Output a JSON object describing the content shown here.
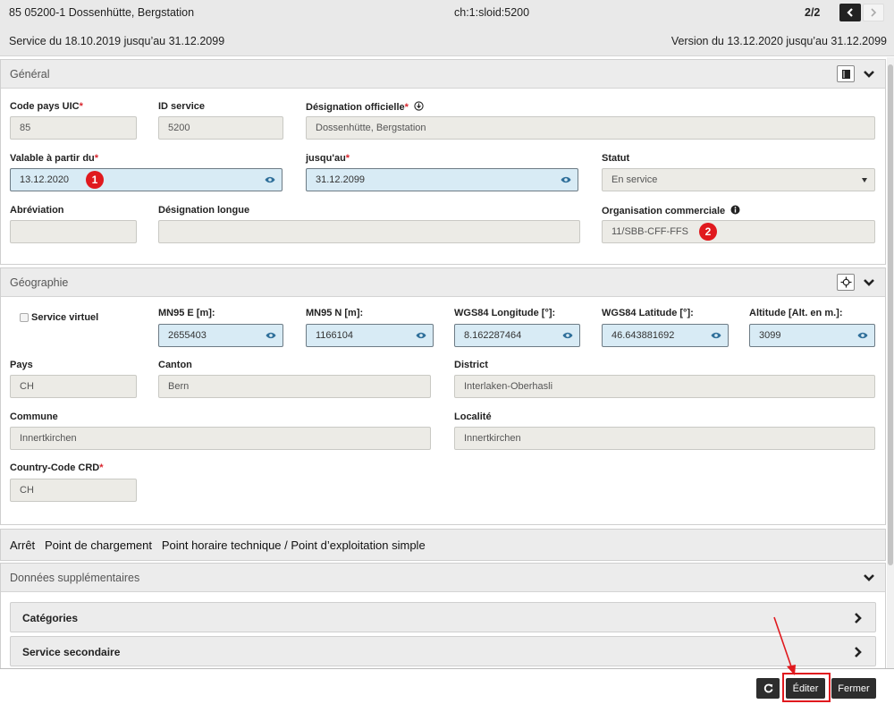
{
  "header": {
    "title": "85 05200-1 Dossenhütte, Bergstation",
    "sloid": "ch:1:sloid:5200",
    "count": "2/2",
    "service": "Service du 18.10.2019 jusqu’au 31.12.2099",
    "version": "Version du 13.12.2020 jusqu’au 31.12.2099"
  },
  "general": {
    "title": "Général",
    "code_pays_label": "Code pays UIC",
    "code_pays_value": "85",
    "id_service_label": "ID service",
    "id_service_value": "5200",
    "designation_officielle_label": "Désignation officielle",
    "designation_officielle_value": "Dossenhütte, Bergstation",
    "valable_label": "Valable à partir du",
    "valable_value": "13.12.2020",
    "jusquau_label": "jusqu'au",
    "jusquau_value": "31.12.2099",
    "statut_label": "Statut",
    "statut_value": "En service",
    "abreviation_label": "Abréviation",
    "abreviation_value": "",
    "designation_longue_label": "Désignation longue",
    "designation_longue_value": "",
    "org_commerciale_label": "Organisation commerciale",
    "org_commerciale_value": "11/SBB-CFF-FFS",
    "required_mark": "*"
  },
  "badges": {
    "one": "1",
    "two": "2"
  },
  "geographie": {
    "title": "Géographie",
    "service_virtuel_label": "Service virtuel",
    "mn95e_label": "MN95 E [m]:",
    "mn95e_value": "2655403",
    "mn95n_label": "MN95 N [m]:",
    "mn95n_value": "1166104",
    "wgs_lon_label": "WGS84 Longitude [°]:",
    "wgs_lon_value": "8.162287464",
    "wgs_lat_label": "WGS84 Latitude [°]:",
    "wgs_lat_value": "46.643881692",
    "altitude_label": "Altitude [Alt. en m.]:",
    "altitude_value": "3099",
    "pays_label": "Pays",
    "pays_value": "CH",
    "canton_label": "Canton",
    "canton_value": "Bern",
    "district_label": "District",
    "district_value": "Interlaken-Oberhasli",
    "commune_label": "Commune",
    "commune_value": "Innertkirchen",
    "localite_label": "Localité",
    "localite_value": "Innertkirchen",
    "country_code_label": "Country-Code CRD",
    "country_code_value": "CH"
  },
  "types_bar": {
    "arret": "Arrêt",
    "chargement": "Point de chargement",
    "horaire": "Point horaire technique / Point d’exploitation simple"
  },
  "donnees": {
    "title": "Données supplémentaires",
    "categories": "Catégories",
    "service_secondaire": "Service secondaire"
  },
  "footer": {
    "editer": "Éditer",
    "fermer": "Fermer"
  },
  "colors": {
    "highlight": "#e0191e",
    "field_blue": "#d8ebf5",
    "field_grey": "#ecebe6",
    "button_dark": "#2d2d2d"
  }
}
